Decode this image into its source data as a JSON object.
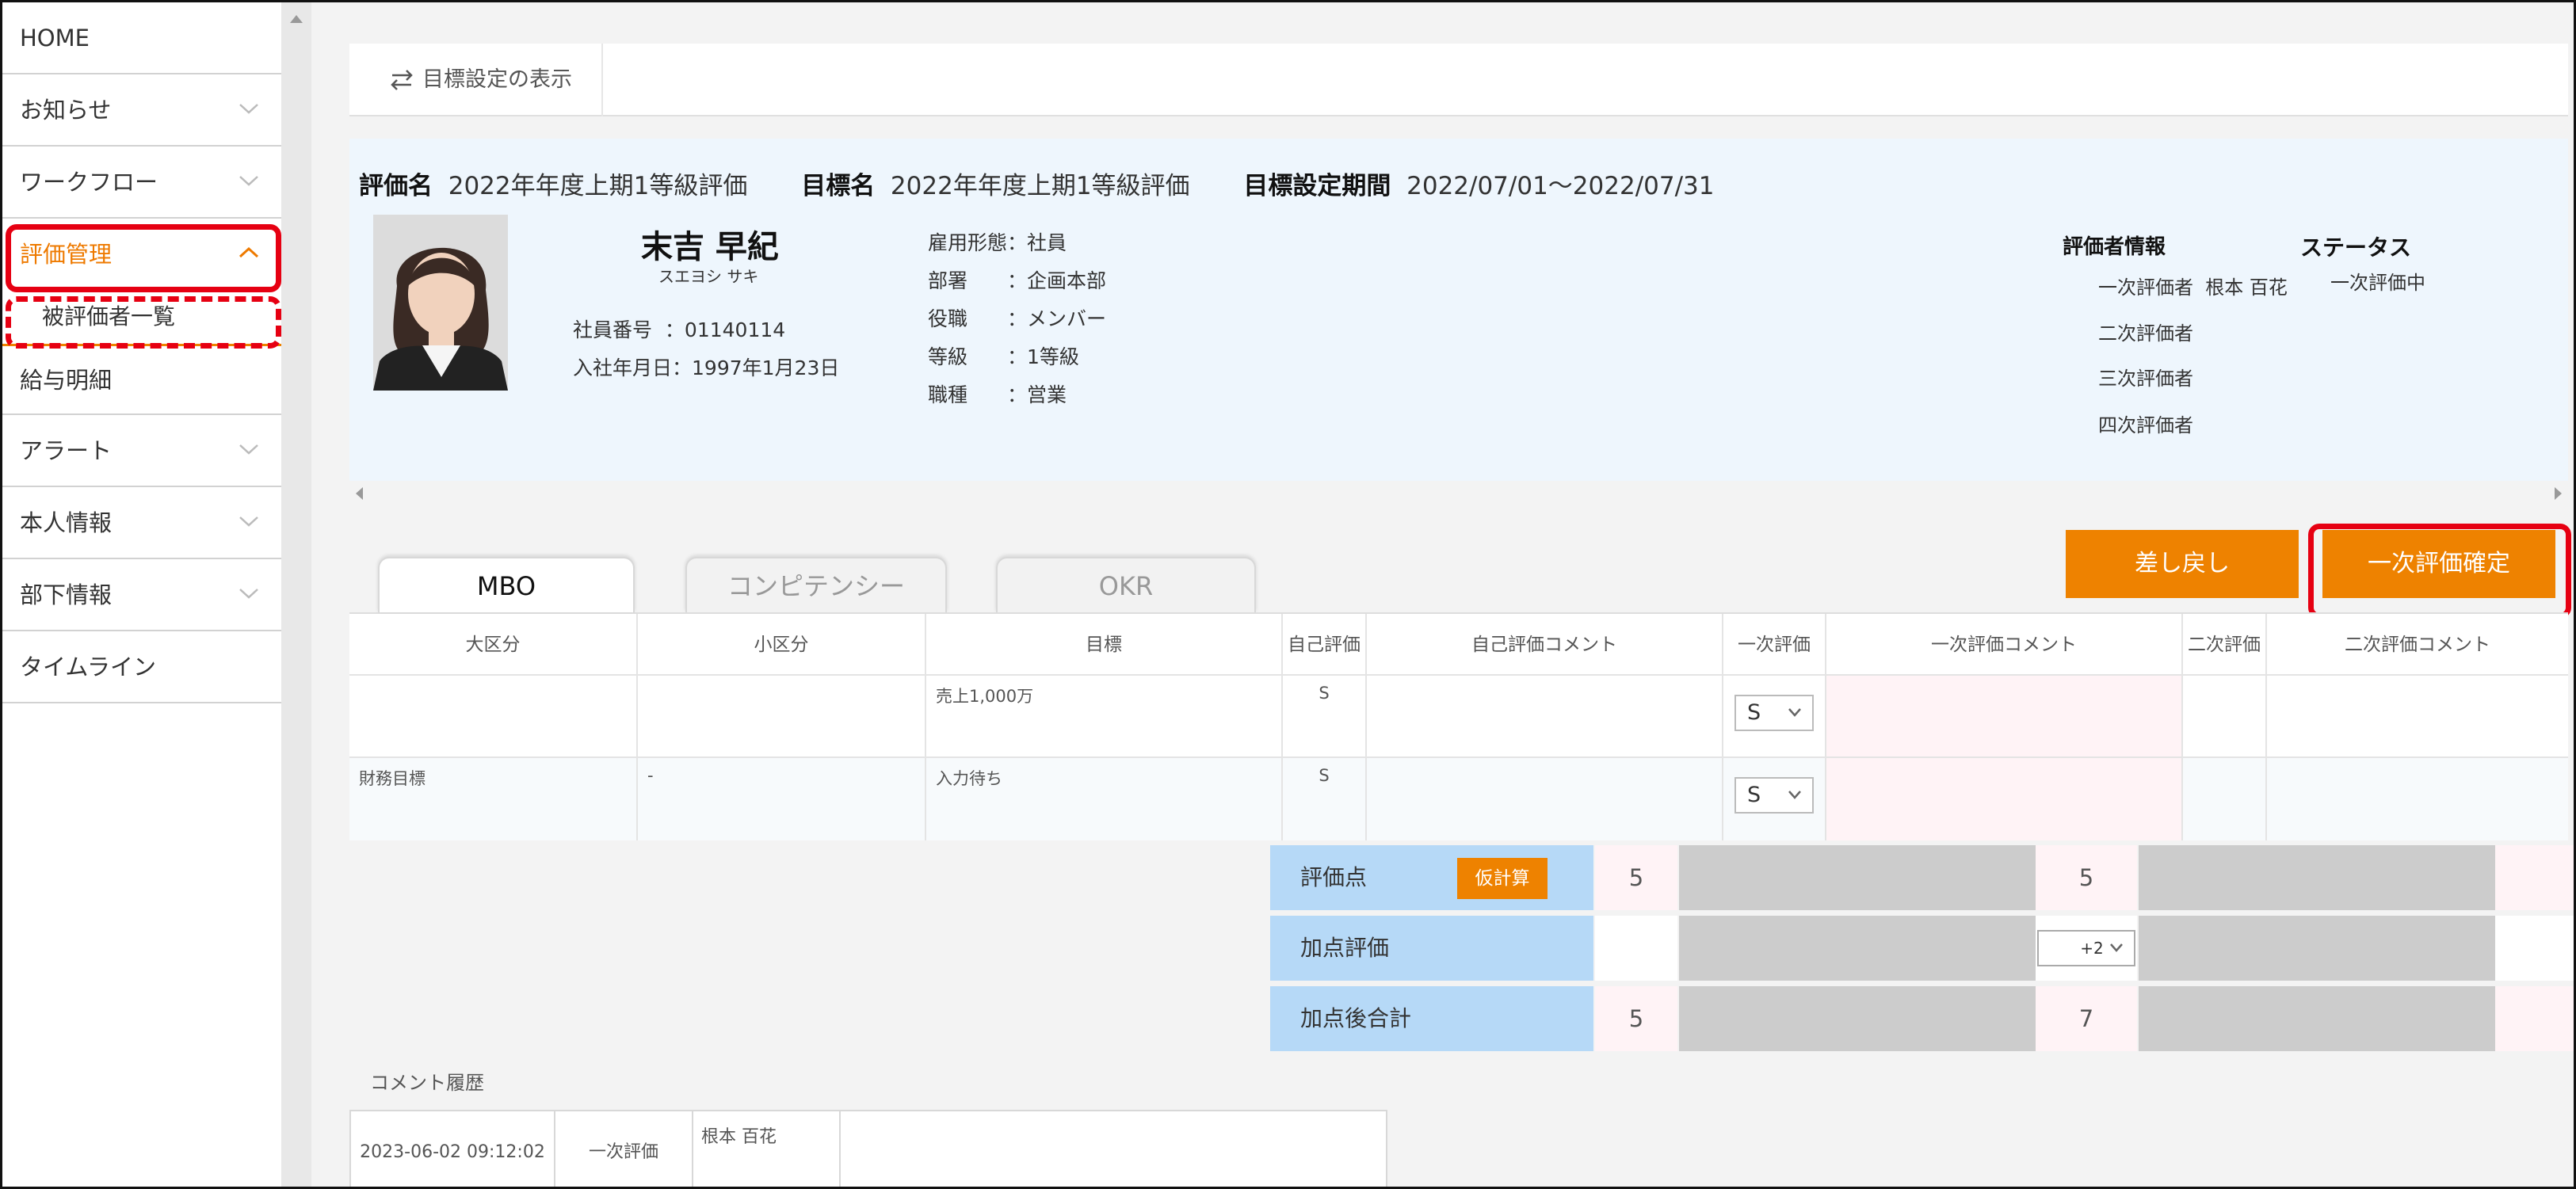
{
  "sidebar": {
    "items": [
      {
        "label": "HOME"
      },
      {
        "label": "お知らせ"
      },
      {
        "label": "ワークフロー"
      },
      {
        "label": "評価管理"
      },
      {
        "label": "被評価者一覧"
      },
      {
        "label": "給与明細"
      },
      {
        "label": "アラート"
      },
      {
        "label": "本人情報"
      },
      {
        "label": "部下情報"
      },
      {
        "label": "タイムライン"
      }
    ]
  },
  "toolbar": {
    "toggle_label": "目標設定の表示"
  },
  "header": {
    "eval_name_label": "評価名",
    "eval_name": "2022年年度上期1等級評価",
    "goal_name_label": "目標名",
    "goal_name": "2022年年度上期1等級評価",
    "period_label": "目標設定期間",
    "period": "2022/07/01～2022/07/31"
  },
  "employee": {
    "name": "末吉 早紀",
    "kana": "スエヨシ サキ",
    "number_label": "社員番号",
    "number": "01140114",
    "join_label": "入社年月日",
    "join_date": "1997年1月23日",
    "fields": [
      {
        "label": "雇用形態",
        "value": "社員"
      },
      {
        "label": "部署",
        "value": "企画本部"
      },
      {
        "label": "役職",
        "value": "メンバー"
      },
      {
        "label": "等級",
        "value": "1等級"
      },
      {
        "label": "職種",
        "value": "営業"
      }
    ]
  },
  "evaluators": {
    "title": "評価者情報",
    "rows": [
      {
        "label": "一次評価者",
        "name": "根本 百花"
      },
      {
        "label": "二次評価者",
        "name": ""
      },
      {
        "label": "三次評価者",
        "name": ""
      },
      {
        "label": "四次評価者",
        "name": ""
      }
    ]
  },
  "status": {
    "title": "ステータス",
    "value": "一次評価中"
  },
  "tabs": [
    {
      "label": "MBO"
    },
    {
      "label": "コンピテンシー"
    },
    {
      "label": "OKR"
    }
  ],
  "buttons": {
    "return": "差し戻し",
    "confirm": "一次評価確定",
    "calc": "仮計算"
  },
  "table": {
    "headers": [
      "大区分",
      "小区分",
      "目標",
      "自己評価",
      "自己評価コメント",
      "一次評価",
      "一次評価コメント",
      "二次評価",
      "二次評価コメント"
    ],
    "rows": [
      {
        "major": "",
        "minor": "",
        "goal": "売上1,000万",
        "self": "S",
        "first": "S"
      },
      {
        "major": "財務目標",
        "minor": "-",
        "goal": "入力待ち",
        "self": "S",
        "first": "S"
      }
    ]
  },
  "scores": {
    "rows": [
      {
        "label": "評価点",
        "self": "5",
        "first": "5"
      },
      {
        "label": "加点評価",
        "self": "",
        "first": "+2"
      },
      {
        "label": "加点後合計",
        "self": "5",
        "first": "7"
      }
    ]
  },
  "comments": {
    "title": "コメント履歴",
    "rows": [
      {
        "date": "2023-06-02 09:12:02",
        "type": "一次評価",
        "author": "根本 百花",
        "text": ""
      }
    ]
  },
  "colors": {
    "accent": "#ee8200",
    "highlight": "#e60012",
    "score_label_bg": "#b6d9f7",
    "info_bg": "#eef6fd"
  }
}
